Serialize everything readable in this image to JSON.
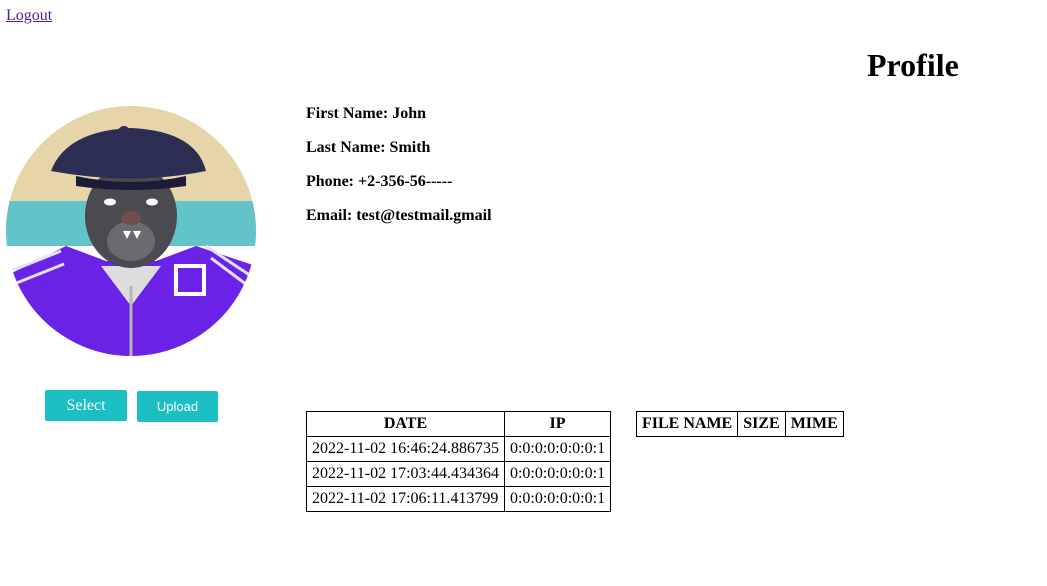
{
  "header": {
    "logout_label": "Logout",
    "title": "Profile"
  },
  "profile": {
    "first_name": "First Name: John",
    "last_name": "Last Name: Smith",
    "phone": "Phone: +2-356-56-----",
    "email": "Email: test@testmail.gmail",
    "avatar_icon": "avatar-image"
  },
  "buttons": {
    "select_label": "Select",
    "upload_label": "Upload",
    "accent": "#1bbfc2"
  },
  "login_table": {
    "headers": [
      "DATE",
      "IP"
    ],
    "rows": [
      [
        "2022-11-02 16:46:24.886735",
        "0:0:0:0:0:0:0:1"
      ],
      [
        "2022-11-02 17:03:44.434364",
        "0:0:0:0:0:0:0:1"
      ],
      [
        "2022-11-02 17:06:11.413799",
        "0:0:0:0:0:0:0:1"
      ]
    ]
  },
  "files_table": {
    "headers": [
      "FILE NAME",
      "SIZE",
      "MIME"
    ],
    "rows": []
  }
}
